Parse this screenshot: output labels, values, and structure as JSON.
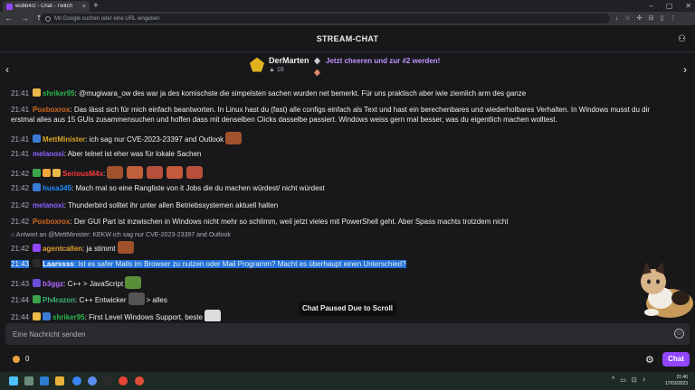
{
  "browser": {
    "tab_title": "wubb4rz - Chat - Twitch",
    "tab_close": "×",
    "new_tab": "+",
    "window_buttons": [
      "–",
      "▢",
      "✕"
    ],
    "nav": [
      "←",
      "→",
      "↻"
    ],
    "omnibox_placeholder": "Mit Google suchen oder eine URL eingeben",
    "extension_icons": [
      "↓",
      "☆",
      "✣",
      "⊟",
      "▯",
      "⋮"
    ]
  },
  "chat": {
    "header_title": "STREAM-CHAT",
    "users_icon": "⚇",
    "leaderboard": {
      "prev": "‹",
      "next": "›",
      "top_cheerer": "DerMarten",
      "top_bits": "16",
      "promo_line1": "Jetzt cheeren und zur #2 werden!",
      "promo_line2": ""
    },
    "messages": [
      {
        "time": "21:41",
        "user": "shriker95",
        "color": "#29b64a",
        "badges": [
          "#e9b949"
        ],
        "text": ": @mugiwara_ow des war ja des komischste die simpelsten sachen wurden net bemerkt. Für uns praktisch aber iwie ziemlich arm des ganze"
      },
      {
        "time": "21:41",
        "user": "Poxboxrox",
        "color": "#d2691e",
        "badges": [],
        "text": ": Das lässt sich für mich einfach beantworten. In Linux hast du (fast) alle configs einfach als Text und hast ein berechenbares und wiederholbares Verhalten. In Windows musst du dir"
      },
      {
        "time": "",
        "user": "",
        "color": "",
        "badges": [],
        "text": "erstmal alles aus 15 GUIs zusammensuchen und hoffen dass mit denselben Clicks dasselbe passiert. Windows weiss gern mal besser, was du eigentlich machen wolltest."
      },
      {
        "time": "21:41",
        "user": "MettMinister",
        "color": "#daa520",
        "badges": [
          "#3a7bd5"
        ],
        "text": ": ich sag nur CVE-2023-23397 and Outlook"
      },
      {
        "time": "21:41",
        "user": "melanoxi",
        "color": "#8a64ff",
        "badges": [],
        "text": ": Aber telnet ist eher was für lokale Sachen"
      },
      {
        "time": "21:42",
        "user": "SeriousM4x",
        "color": "#ff3b3b",
        "badges": [
          "#3ca54a",
          "#f2a33a",
          "#e9b949"
        ],
        "text": ":"
      },
      {
        "time": "21:42",
        "user": "husa345",
        "color": "#1e90ff",
        "badges": [
          "#3a7bd5"
        ],
        "text": ": Mach mal so eine Rangliste von it Jobs die du machen würdest/ nicht würdest"
      },
      {
        "time": "21:42",
        "user": "melanoxi",
        "color": "#8a64ff",
        "badges": [],
        "text": ": Thunderbird solltet ihr unter allen Betriebssystemen aktuell halten"
      },
      {
        "time": "21:42",
        "user": "Poxboxrox",
        "color": "#d2691e",
        "badges": [],
        "text": ": Der GUI Part ist inzwischen in Windows nicht mehr so schlimm, weil jetzt vieles mit PowerShell geht. Aber Spass machts trotzdem nicht"
      },
      {
        "time": "21:42",
        "user": "agentcallen",
        "color": "#e0a030",
        "badges": [
          "#9147ff"
        ],
        "text": ": ja stimmt"
      },
      {
        "time": "21:43",
        "user": "Laarssss",
        "color": "#ffffff",
        "badges": [
          "#2b2b2b"
        ],
        "text": ": Ist es safer Mails im Browser zu nutzen oder Mail Programm? Macht es überhaupt einen Unterschied?"
      },
      {
        "time": "21:43",
        "user": "b3ggz",
        "color": "#b36bff",
        "badges": [
          "#6a4fd8"
        ],
        "text": ": C++ > JavaScript"
      },
      {
        "time": "21:44",
        "user": "Ph4razon",
        "color": "#3cb371",
        "badges": [
          "#3ca54a"
        ],
        "text": ": C++ Entwicker"
      },
      {
        "time": "21:44",
        "user": "shriker95",
        "color": "#29b64a",
        "badges": [
          "#e9b949",
          "#3a7bd5"
        ],
        "text": ": First Level Windows Support, beste"
      }
    ],
    "reply_context": "Antwort an @MettMinister: KEKW ich sag nur CVE-2023-23397 and Outlook",
    "trailing_text_1": "> alles",
    "paused_label": "Chat Paused Due to Scroll",
    "input_placeholder": "Eine Nachricht senden",
    "emoji_icon": "☺",
    "points": "0",
    "settings_icon": "⚙",
    "chat_button": "Chat"
  },
  "taskbar": {
    "time": "21:46",
    "date": "17/03/2023",
    "tray_icons": [
      "^",
      "▭",
      "⊡",
      "♪"
    ]
  },
  "colors": {
    "accent": "#9147ff",
    "selection": "#1f6fd6",
    "background": "#18181b"
  }
}
